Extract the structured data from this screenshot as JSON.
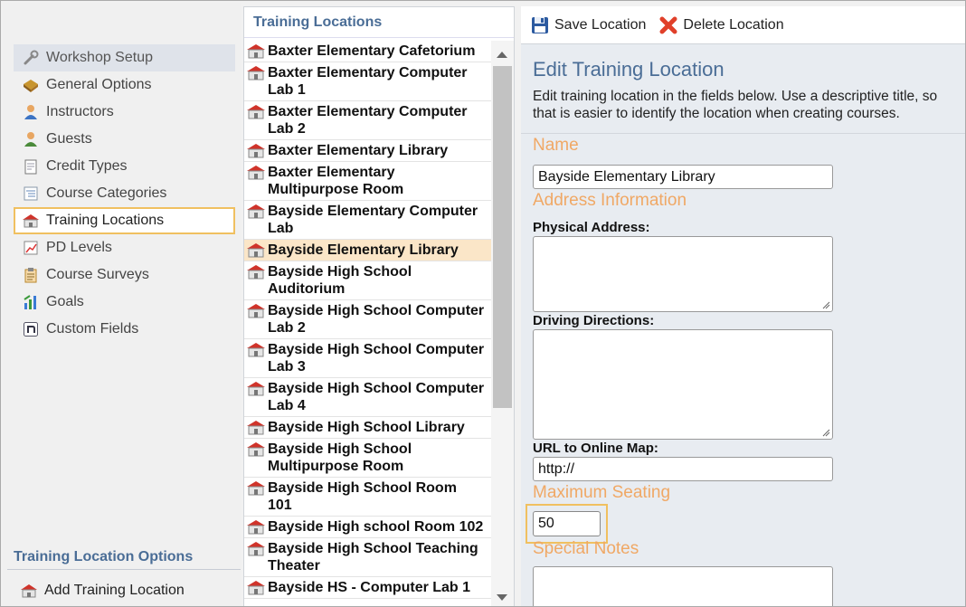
{
  "sidebar": {
    "items": [
      {
        "label": "Workshop Setup",
        "icon": "wrench-icon"
      },
      {
        "label": "General Options",
        "icon": "options-icon"
      },
      {
        "label": "Instructors",
        "icon": "instructor-icon"
      },
      {
        "label": "Guests",
        "icon": "guest-icon"
      },
      {
        "label": "Credit Types",
        "icon": "credit-icon"
      },
      {
        "label": "Course Categories",
        "icon": "categories-icon"
      },
      {
        "label": "Training Locations",
        "icon": "building-icon"
      },
      {
        "label": "PD Levels",
        "icon": "levels-icon"
      },
      {
        "label": "Course Surveys",
        "icon": "survey-icon"
      },
      {
        "label": "Goals",
        "icon": "goals-icon"
      },
      {
        "label": "Custom Fields",
        "icon": "custom-fields-icon"
      }
    ],
    "options_title": "Training Location Options",
    "add_label": "Add Training Location"
  },
  "list": {
    "title": "Training Locations",
    "items": [
      [
        "Baxter Elementary Cafetorium"
      ],
      [
        "Baxter Elementary Computer",
        "Lab 1"
      ],
      [
        "Baxter Elementary Computer",
        "Lab 2"
      ],
      [
        "Baxter Elementary Library"
      ],
      [
        "Baxter Elementary",
        "Multipurpose Room"
      ],
      [
        "Bayside Elementary Computer",
        "Lab"
      ],
      [
        "Bayside Elementary Library"
      ],
      [
        "Bayside High School",
        "Auditorium"
      ],
      [
        "Bayside High School Computer",
        "Lab 2"
      ],
      [
        "Bayside High School Computer",
        "Lab 3"
      ],
      [
        "Bayside High School Computer",
        "Lab 4"
      ],
      [
        "Bayside High School Library"
      ],
      [
        "Bayside High School",
        "Multipurpose Room"
      ],
      [
        "Bayside High School Room",
        "101"
      ],
      [
        "Bayside High school Room 102"
      ],
      [
        "Bayside High School Teaching",
        "Theater"
      ],
      [
        "Bayside HS - Computer Lab 1"
      ]
    ]
  },
  "toolbar": {
    "save_label": "Save Location",
    "delete_label": "Delete Location"
  },
  "edit": {
    "title": "Edit Training Location",
    "desc": "Edit training location in the fields below. Use a descriptive title, so that is easier to identify the location when creating courses.",
    "name_section": "Name",
    "name_value": "Bayside Elementary Library",
    "address_section": "Address Information",
    "physical_label": "Physical Address:",
    "physical_value": "",
    "directions_label": "Driving Directions:",
    "directions_value": "",
    "map_label": "URL to Online Map:",
    "map_value": "http://",
    "seating_section": "Maximum Seating",
    "seating_value": "50",
    "notes_section": "Special Notes",
    "notes_value": ""
  },
  "colors": {
    "accent": "#4a6d96",
    "section": "#f0a865",
    "highlight": "#f0c060",
    "selected": "#fbe6c8"
  }
}
